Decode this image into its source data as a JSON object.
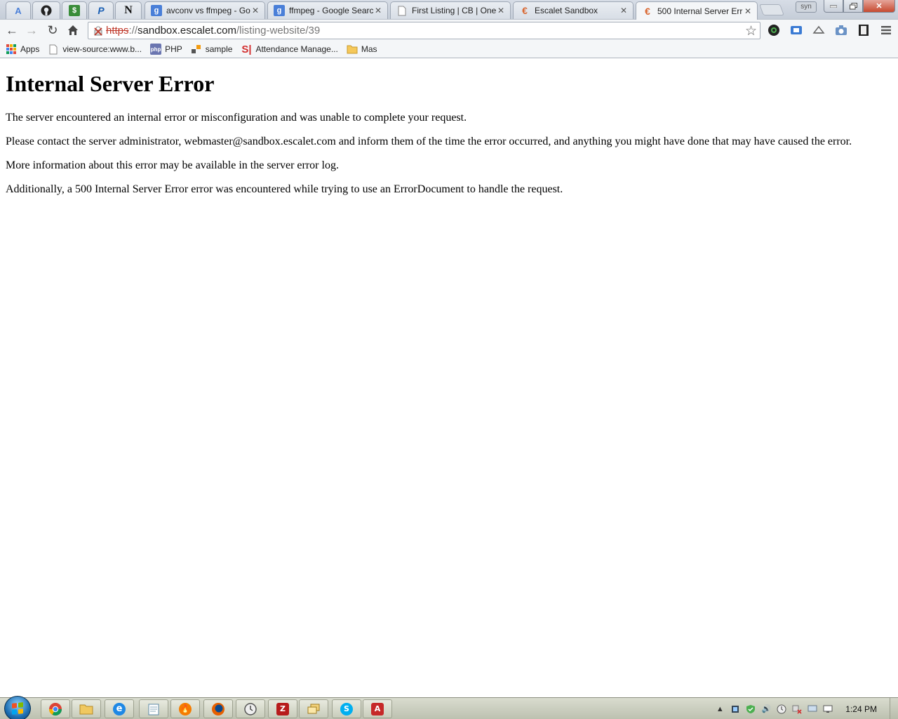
{
  "browser": {
    "user_badge": "syn",
    "tabs": [
      {
        "title": "avconv vs ffmpeg - Go",
        "favicon": "google-g-icon",
        "color": "#4a7fd8",
        "glyph": "g"
      },
      {
        "title": "ffmpeg - Google Searc",
        "favicon": "google-g-icon",
        "color": "#4a7fd8",
        "glyph": "g"
      },
      {
        "title": "First Listing | CB | One",
        "favicon": "page-icon",
        "color": "#999999",
        "glyph": "▯"
      },
      {
        "title": "Escalet Sandbox",
        "favicon": "escalet-icon",
        "color": "#d9662f",
        "glyph": "€"
      },
      {
        "title": "500 Internal Server Err",
        "favicon": "escalet-icon",
        "color": "#d9662f",
        "glyph": "€"
      }
    ],
    "pinned_tabs": [
      {
        "name": "google-docs-icon",
        "glyph": "A",
        "color": "#4a7fd8"
      },
      {
        "name": "github-icon",
        "glyph": "●",
        "color": "#222222"
      },
      {
        "name": "money-icon",
        "glyph": "$",
        "color": "#3a8d3a"
      },
      {
        "name": "paypal-icon",
        "glyph": "P",
        "color": "#1a5fb4"
      },
      {
        "name": "notion-icon",
        "glyph": "N",
        "color": "#111111"
      }
    ],
    "address": {
      "scheme": "https",
      "separator": "://",
      "host": "sandbox.escalet.com",
      "path": "/listing-website/39"
    },
    "bookmarks": [
      {
        "label": "Apps",
        "icon": "apps-grid-icon"
      },
      {
        "label": "view-source:www.b...",
        "icon": "page-icon"
      },
      {
        "label": "PHP",
        "icon": "php-icon"
      },
      {
        "label": "sample",
        "icon": "sample-icon"
      },
      {
        "label": "Attendance Manage...",
        "icon": "attendance-icon"
      },
      {
        "label": "Mas",
        "icon": "folder-icon"
      }
    ]
  },
  "page": {
    "heading": "Internal Server Error",
    "paragraphs": [
      "The server encountered an internal error or misconfiguration and was unable to complete your request.",
      "Please contact the server administrator, webmaster@sandbox.escalet.com and inform them of the time the error occurred, and anything you might have done that may have caused the error.",
      "More information about this error may be available in the server error log.",
      "Additionally, a 500 Internal Server Error error was encountered while trying to use an ErrorDocument to handle the request."
    ]
  },
  "taskbar": {
    "clock": "1:24 PM"
  }
}
